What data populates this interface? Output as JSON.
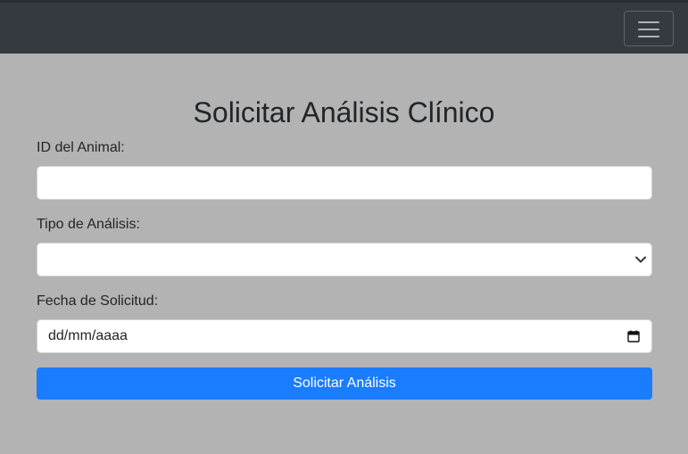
{
  "navbar": {
    "toggler_icon": "hamburger-menu-icon"
  },
  "form": {
    "title": "Solicitar Análisis Clínico",
    "animal_id": {
      "label": "ID del Animal:",
      "value": ""
    },
    "analysis_type": {
      "label": "Tipo de Análisis:",
      "selected": ""
    },
    "request_date": {
      "label": "Fecha de Solicitud:",
      "placeholder": "dd/mm/aaaa",
      "icon": "calendar-icon"
    },
    "submit_label": "Solicitar Análisis"
  },
  "colors": {
    "navbar": "#343a40",
    "background": "#b3b3b3",
    "primary": "#1a7cff"
  }
}
